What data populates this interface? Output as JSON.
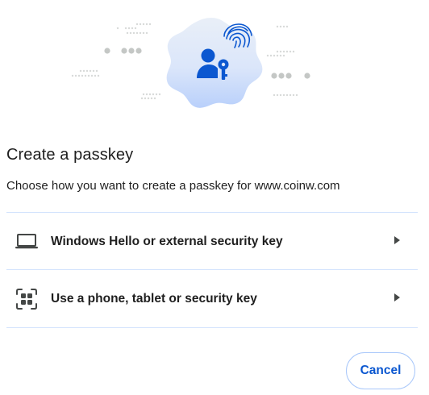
{
  "dialog": {
    "title": "Create a passkey",
    "subtitle": "Choose how you want to create a passkey for www.coinw.com"
  },
  "options": [
    {
      "label": "Windows Hello or external security key",
      "icon": "laptop-icon"
    },
    {
      "label": "Use a phone, tablet or security key",
      "icon": "qr-code-icon"
    }
  ],
  "actions": {
    "cancel_label": "Cancel"
  },
  "colors": {
    "accent": "#0b57d0",
    "divider": "#d3e3fd",
    "badge_light": "#e8eef9",
    "badge_blue": "#c2d7fb",
    "hero_icon": "#0b57d0",
    "dots": "#c4c7c5"
  }
}
